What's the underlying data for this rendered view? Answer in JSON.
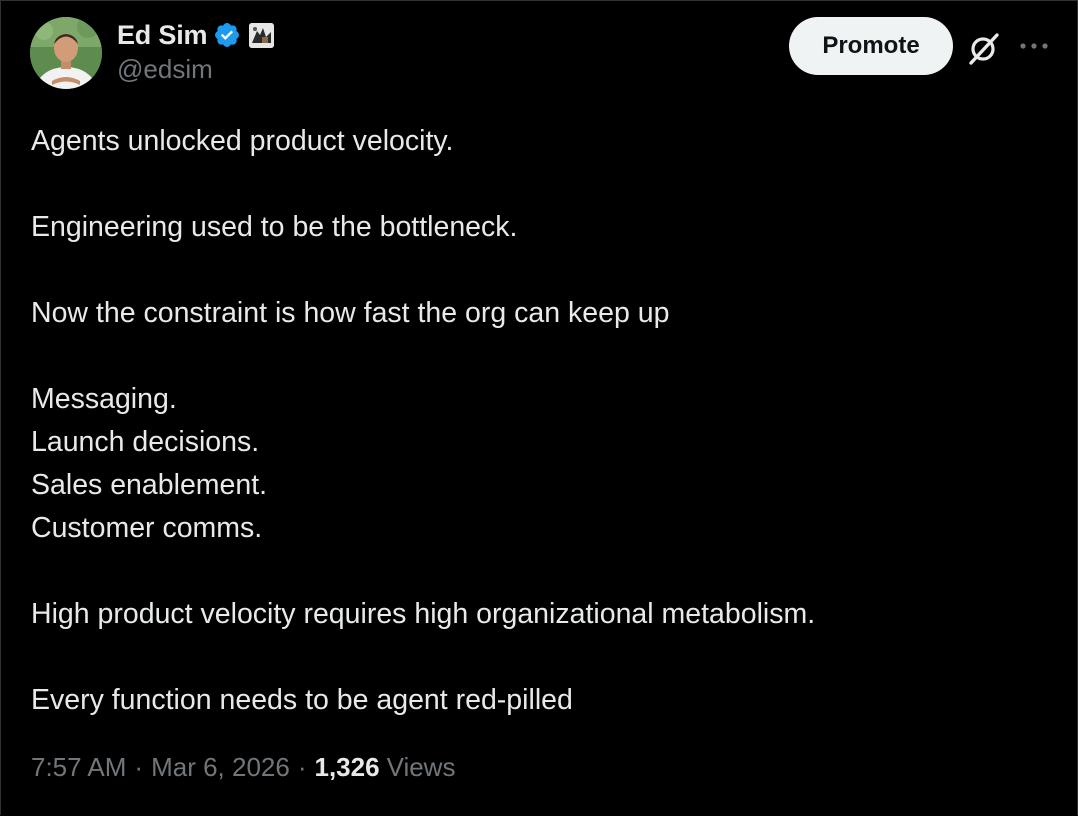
{
  "author": {
    "display_name": "Ed Sim",
    "handle": "@edsim",
    "verified": true,
    "avatar_icon": "profile-photo",
    "affiliation_icon": "affiliate-badge"
  },
  "actions": {
    "promote_label": "Promote",
    "grok_icon": "grok-icon",
    "more_icon": "more-icon"
  },
  "tweet": {
    "lines": {
      "l1": "Agents unlocked product velocity.",
      "l2": "Engineering used to be the bottleneck.",
      "l3": "Now the constraint is how fast the org can keep up",
      "l4": "Messaging.",
      "l5": "Launch decisions.",
      "l6": "Sales enablement.",
      "l7": "Customer comms.",
      "l8": "High product velocity requires high organizational metabolism.",
      "l9": "Every function needs to be agent red-pilled"
    }
  },
  "meta": {
    "time": "7:57 AM",
    "separator": "·",
    "date": "Mar 6, 2026",
    "views_count": "1,326",
    "views_label": "Views"
  },
  "colors": {
    "background": "#000000",
    "text": "#e7e9ea",
    "muted": "#71767b",
    "verified_blue": "#1d9bf0",
    "button_bg": "#eff3f4"
  }
}
